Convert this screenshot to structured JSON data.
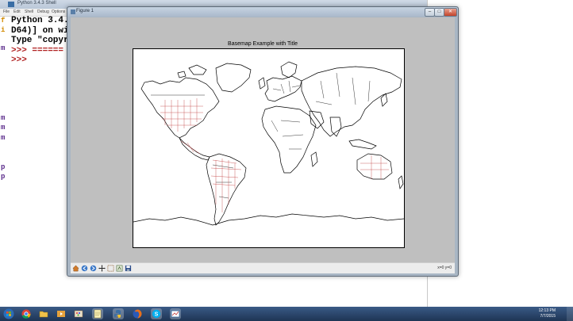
{
  "shell": {
    "title": "Python 3.4.3 Shell",
    "menu": [
      "File",
      "Edit",
      "Shell",
      "Debug",
      "Options",
      "Windows",
      "Help"
    ],
    "gutter": [
      "f",
      "i",
      "m",
      "m",
      "m",
      "m",
      "p",
      "p"
    ],
    "lines": [
      "Python 3.4.",
      "D64)] on wi",
      "Type \"copyr",
      ">>> ======",
      ">>>"
    ]
  },
  "figure": {
    "window_title": "Figure 1",
    "plot_title": "Basemap Example with Title",
    "buttons": {
      "minimize": "–",
      "maximize": "□",
      "close": "✕"
    },
    "coords": "x=0 y=0"
  },
  "toolbar": {
    "tools": [
      "home",
      "back",
      "forward",
      "pan",
      "zoom",
      "configure",
      "save"
    ]
  },
  "taskbar": {
    "time": "12:13 PM",
    "date": "7/7/2015",
    "apps": [
      "start",
      "chrome",
      "folder",
      "media",
      "notepad",
      "python",
      "firefox",
      "skype",
      "python2"
    ]
  },
  "colors": {
    "accent": "#c03a3a",
    "map_line": "#000000"
  }
}
